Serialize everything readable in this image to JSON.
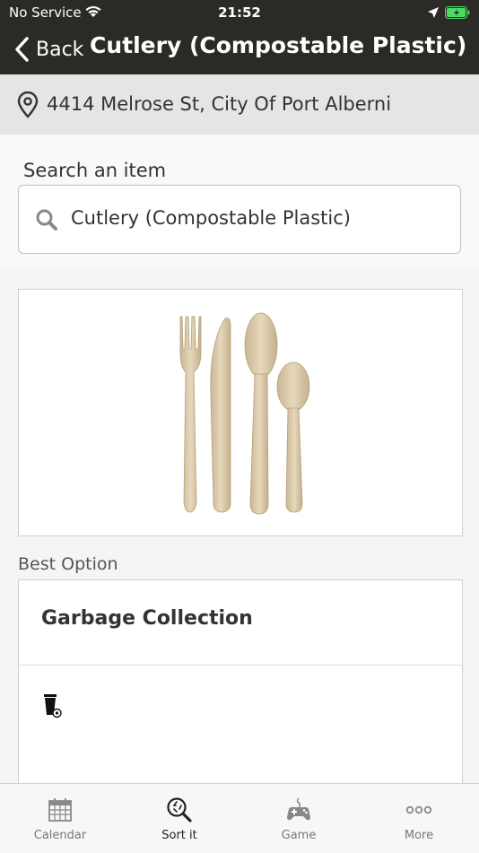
{
  "status_bar": {
    "carrier": "No Service",
    "time": "21:52"
  },
  "nav": {
    "back_label": "Back",
    "title": "Cutlery (Compostable Plastic)"
  },
  "location": {
    "address": "4414 Melrose St, City Of Port Alberni"
  },
  "search": {
    "label": "Search an item",
    "value": "Cutlery (Compostable Plastic)"
  },
  "item_image": {
    "alt": "wooden fork, knife, and spoons"
  },
  "best_option": {
    "label": "Best Option",
    "title": "Garbage Collection",
    "icon": "garbage-bin-icon"
  },
  "tabs": [
    {
      "label": "Calendar",
      "icon": "calendar-icon",
      "active": false
    },
    {
      "label": "Sort it",
      "icon": "sort-search-icon",
      "active": true
    },
    {
      "label": "Game",
      "icon": "game-controller-icon",
      "active": false
    },
    {
      "label": "More",
      "icon": "more-dots-icon",
      "active": false
    }
  ],
  "colors": {
    "header": "#2c2a27",
    "address_bar": "#e4e5e5",
    "background": "#f4f6f6",
    "battery": "#4cd964"
  }
}
